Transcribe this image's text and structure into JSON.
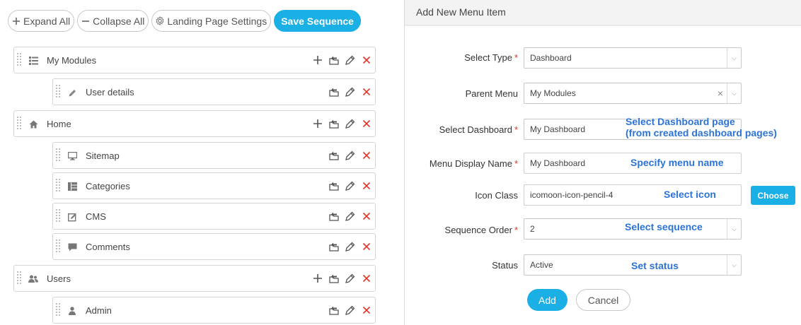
{
  "toolbar": {
    "expand_all": "Expand All",
    "collapse_all": "Collapse All",
    "landing_settings": "Landing Page Settings",
    "save_sequence": "Save Sequence",
    "expand_icon": "plus-icon",
    "collapse_icon": "minus-icon",
    "settings_icon": "gear-icon"
  },
  "menu_items": [
    {
      "label": "My Modules",
      "icon": "list-icon",
      "level": 0
    },
    {
      "label": "User details",
      "icon": "pencil-icon",
      "level": 1
    },
    {
      "label": "Home",
      "icon": "home-icon",
      "level": 0
    },
    {
      "label": "Sitemap",
      "icon": "desktop-icon",
      "level": 1
    },
    {
      "label": "Categories",
      "icon": "layout-icon",
      "level": 1
    },
    {
      "label": "CMS",
      "icon": "edit-icon",
      "level": 1
    },
    {
      "label": "Comments",
      "icon": "comment-icon",
      "level": 1
    },
    {
      "label": "Users",
      "icon": "users-icon",
      "level": 0
    },
    {
      "label": "Admin",
      "icon": "user-icon",
      "level": 1
    }
  ],
  "panel": {
    "title": "Add New Menu Item",
    "fields": {
      "select_type": {
        "label": "Select Type",
        "value": "Dashboard"
      },
      "parent_menu": {
        "label": "Parent Menu",
        "value": "My Modules"
      },
      "select_dashboard": {
        "label": "Select Dashboard",
        "value": "My Dashboard"
      },
      "display_name": {
        "label": "Menu Display Name",
        "value": "My Dashboard"
      },
      "icon_class": {
        "label": "Icon Class",
        "value": "icomoon-icon-pencil-4"
      },
      "sequence_order": {
        "label": "Sequence Order",
        "value": "2"
      },
      "status": {
        "label": "Status",
        "value": "Active"
      }
    },
    "choose_label": "Choose",
    "add_label": "Add",
    "cancel_label": "Cancel",
    "required_mark": "*",
    "clear_mark": "×"
  },
  "annotations": {
    "dashboard_line1": "Select Dashboard page",
    "dashboard_line2": "(from created dashboard pages)",
    "menu_name": "Specify menu name",
    "icon": "Select icon",
    "sequence": "Select sequence",
    "status": "Set status"
  },
  "colors": {
    "accent": "#1ab0e5",
    "delete": "#e0352b",
    "annotation": "#2b74d6"
  }
}
